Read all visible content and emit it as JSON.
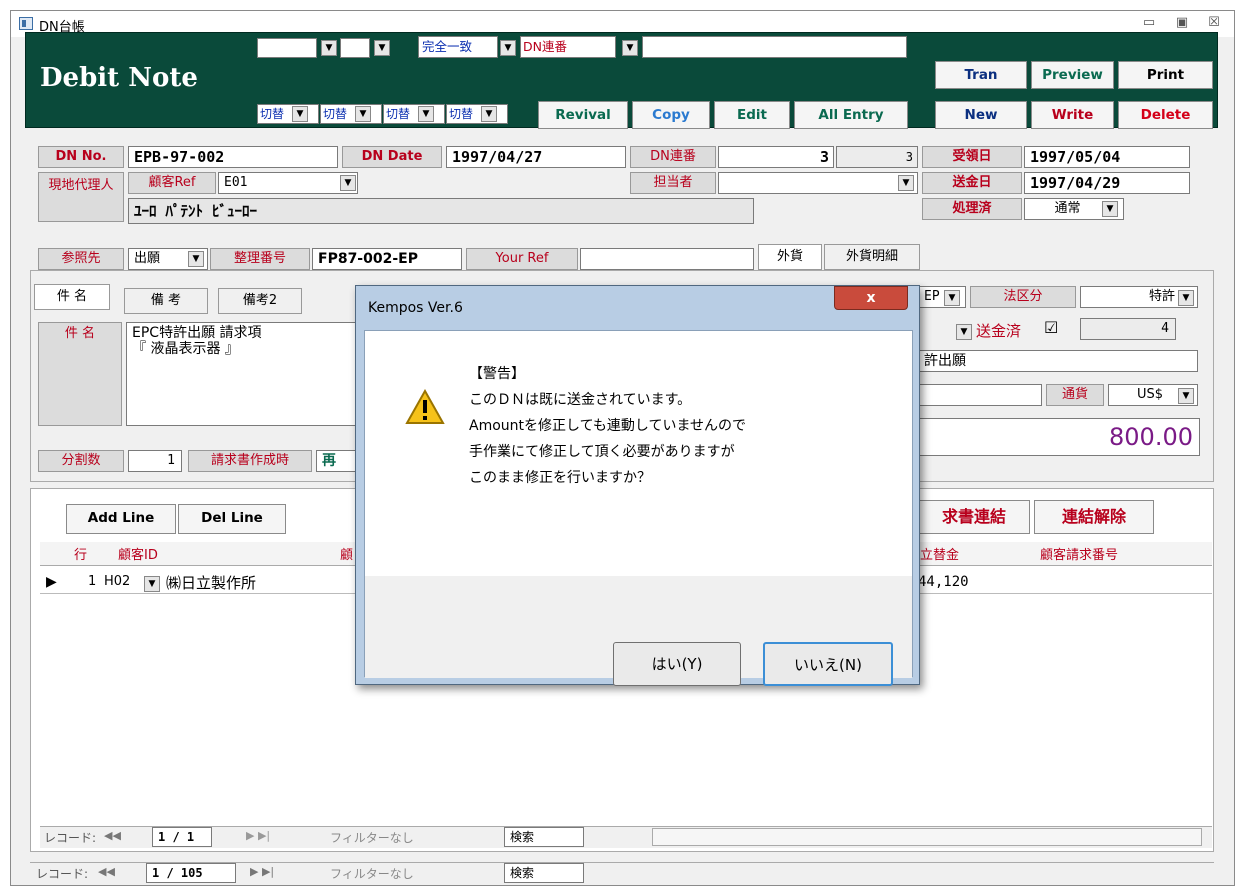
{
  "window": {
    "title": "DN台帳",
    "min": "▭",
    "max": "▣",
    "close": "☒"
  },
  "header": {
    "title": "Debit Note",
    "search_mode": "完全一致",
    "search_field": "DN連番",
    "switch_label": "切替",
    "filters": [
      "切替",
      "切替",
      "切替",
      "切替"
    ]
  },
  "toolbar": {
    "revival": "Revival",
    "copy": "Copy",
    "edit": "Edit",
    "all_entry": "All Entry",
    "tran": "Tran",
    "preview": "Preview",
    "print": "Print",
    "new": "New",
    "write": "Write",
    "delete": "Delete"
  },
  "form": {
    "dn_no_label": "DN No.",
    "dn_no": "EPB-97-002",
    "dn_date_label": "DN Date",
    "dn_date": "1997/04/27",
    "dn_seq_label": "DN連番",
    "dn_seq": "3",
    "dn_seq2": "3",
    "recv_label": "受領日",
    "recv_date": "1997/05/04",
    "tantou_label": "担当者",
    "send_label": "送金日",
    "send_date": "1997/04/29",
    "done_label": "処理済",
    "done_value": "通常",
    "agent_label": "現地代理人",
    "client_ref_label": "顧客Ref",
    "client_ref": "E01",
    "agent_name": "ﾕｰﾛ ﾊﾟﾃﾝﾄ ﾋﾞｭｰﾛｰ",
    "ref_label": "参照先",
    "ref_value": "出願",
    "seiri_label": "整理番号",
    "seiri_value": "FP87-002-EP",
    "your_ref_label": "Your Ref",
    "foreign_tab": "外貨",
    "foreign_detail_tab": "外貨明細"
  },
  "tabs": [
    "件 名",
    "備 考",
    "備考2"
  ],
  "subject": {
    "label": "件 名",
    "text": "EPC特許出願 請求項\n『 液晶表示器 』"
  },
  "right": {
    "ep_value": "EP",
    "law_label": "法区分",
    "law_value": "特許",
    "sent_label": "送金済",
    "sent_check": "☑",
    "count": "4",
    "case_type": "許出願",
    "currency_label": "通貨",
    "currency": "US$",
    "amount": "800.00"
  },
  "split": {
    "label": "分割数",
    "value": "1",
    "invoice_label": "請求書作成時",
    "invoice_value": "再"
  },
  "grid": {
    "add_line": "Add Line",
    "del_line": "Del Line",
    "link": "求書連結",
    "unlink": "連結解除",
    "col_row": "行",
    "col_client": "顧客ID",
    "col_client2": "顧",
    "col_advance": "立替金",
    "col_invoice_no": "顧客請求番号",
    "row_no": "1",
    "row_client": "H02",
    "row_client_name": "㈱日立製作所",
    "row_advance": "44,120"
  },
  "subnav": {
    "record_label": "レコード:",
    "current": "1 / 1",
    "filter": "フィルターなし",
    "search": "検索"
  },
  "mainnav": {
    "record_label": "レコード:",
    "current": "1 / 105",
    "filter": "フィルターなし",
    "search": "検索"
  },
  "dialog": {
    "title": "Kempos Ver.6",
    "close": "x",
    "heading": "【警告】",
    "lines": [
      "このＤＮは既に送金されています。",
      "Amountを修正しても連動していませんので",
      "手作業にて修正して頂く必要がありますが",
      "このまま修正を行いますか？"
    ],
    "yes": "はい(Y)",
    "no": "いいえ(N)"
  },
  "colors": {
    "header_bg": "#0a4a3a",
    "label_red": "#b8001c",
    "btn_green": "#0a6a50",
    "btn_red": "#d40018",
    "amount": "#7a1a86",
    "dialog_frame": "#b8cde4"
  }
}
